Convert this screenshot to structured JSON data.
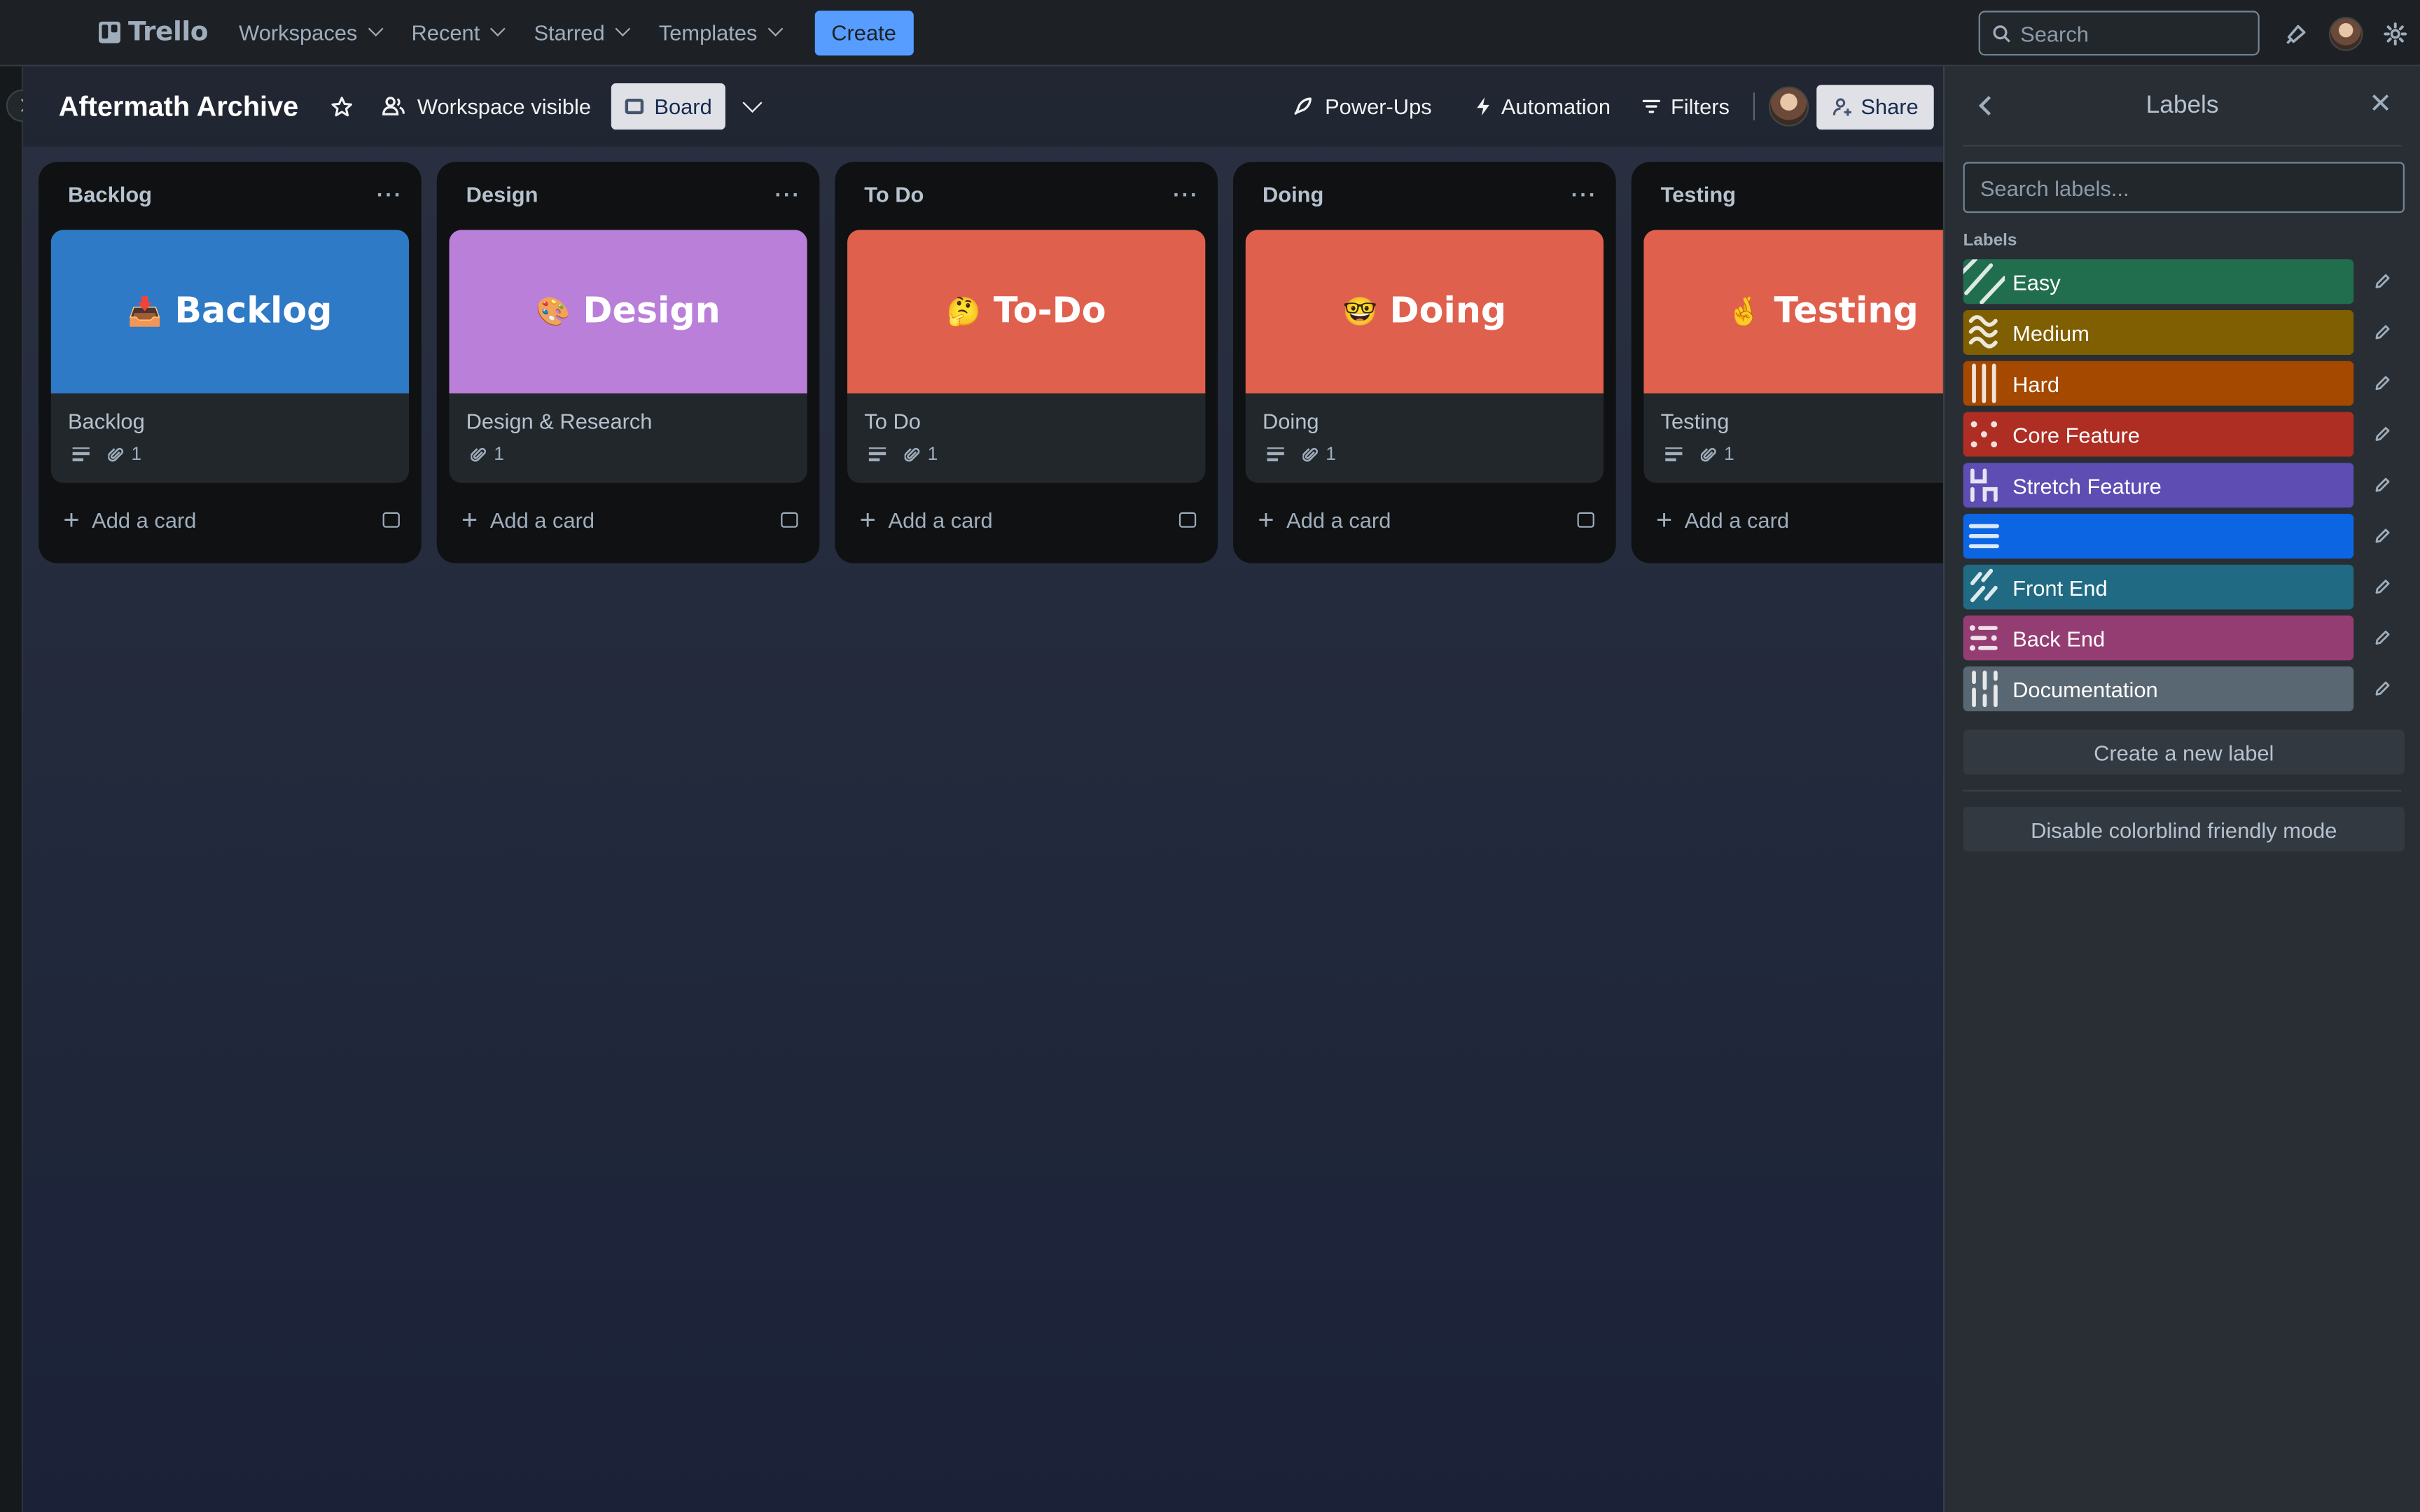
{
  "app": {
    "name": "Trello"
  },
  "topnav": {
    "menus": [
      "Workspaces",
      "Recent",
      "Starred",
      "Templates"
    ],
    "create_label": "Create",
    "search_placeholder": "Search"
  },
  "board": {
    "title": "Aftermath Archive",
    "visibility_label": "Workspace visible",
    "view_label": "Board",
    "powerups_label": "Power-Ups",
    "automation_label": "Automation",
    "filters_label": "Filters",
    "share_label": "Share",
    "add_card_label": "Add a card",
    "more_glyph": "···"
  },
  "lists": [
    {
      "name": "Backlog",
      "cover_emoji": "📥",
      "cover_text": "Backlog",
      "cover_color": "#2f7ac6",
      "card_title": "Backlog",
      "has_description": true,
      "attachments": "1"
    },
    {
      "name": "Design",
      "cover_emoji": "🎨",
      "cover_text": "Design",
      "cover_color": "#b97fd9",
      "card_title": "Design & Research",
      "has_description": false,
      "attachments": "1"
    },
    {
      "name": "To Do",
      "cover_emoji": "🤔",
      "cover_text": "To-Do",
      "cover_color": "#e0604e",
      "card_title": "To Do",
      "has_description": true,
      "attachments": "1"
    },
    {
      "name": "Doing",
      "cover_emoji": "🤓",
      "cover_text": "Doing",
      "cover_color": "#e0604e",
      "card_title": "Doing",
      "has_description": true,
      "attachments": "1"
    },
    {
      "name": "Testing",
      "cover_emoji": "🤞",
      "cover_text": "Testing",
      "cover_color": "#e0604e",
      "card_title": "Testing",
      "has_description": true,
      "attachments": "1"
    }
  ],
  "labels_panel": {
    "title": "Labels",
    "search_placeholder": "Search labels...",
    "section_heading": "Labels",
    "labels": [
      {
        "name": "Easy",
        "color": "#216e4e",
        "pattern": "diagonal"
      },
      {
        "name": "Medium",
        "color": "#7f5f01",
        "pattern": "wave"
      },
      {
        "name": "Hard",
        "color": "#a54800",
        "pattern": "vertical"
      },
      {
        "name": "Core Feature",
        "color": "#ae2e24",
        "pattern": "dots"
      },
      {
        "name": "Stretch Feature",
        "color": "#5e4db2",
        "pattern": "zigzag"
      },
      {
        "name": "",
        "color": "#0c66e4",
        "pattern": "horizontal"
      },
      {
        "name": "Front End",
        "color": "#206a83",
        "pattern": "dashes"
      },
      {
        "name": "Back End",
        "color": "#943d73",
        "pattern": "dash-dot"
      },
      {
        "name": "Documentation",
        "color": "#596773",
        "pattern": "dotted-vertical"
      }
    ],
    "create_label": "Create a new label",
    "colorblind_label": "Disable colorblind friendly mode"
  }
}
